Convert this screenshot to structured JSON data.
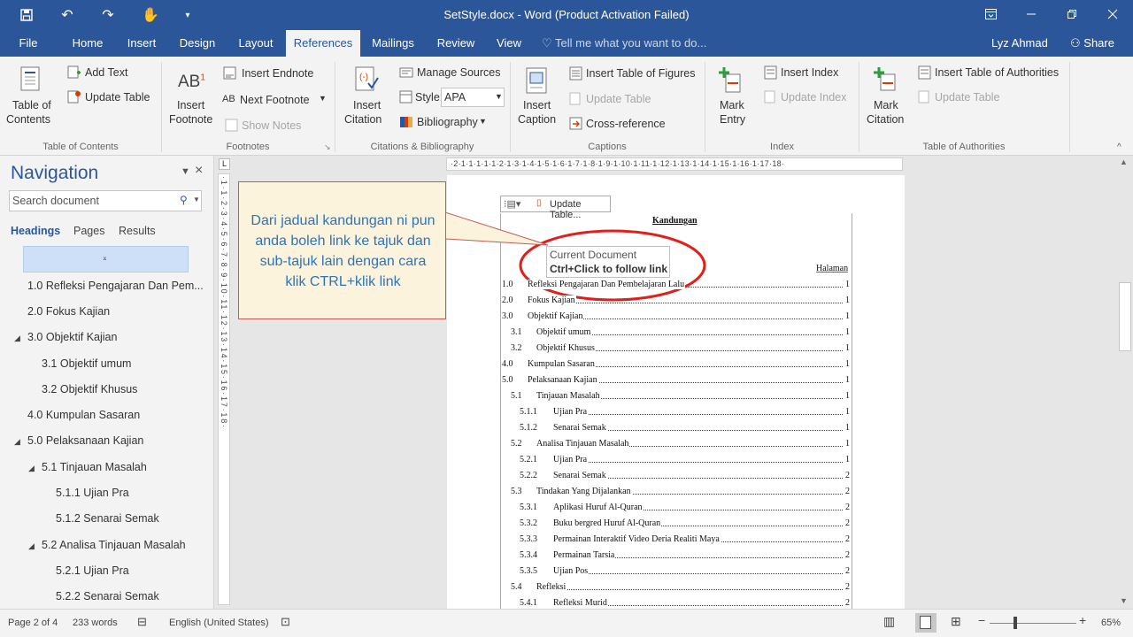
{
  "window": {
    "title": "SetStyle.docx - Word (Product Activation Failed)"
  },
  "tabs": [
    {
      "label": "File"
    },
    {
      "label": "Home"
    },
    {
      "label": "Insert"
    },
    {
      "label": "Design"
    },
    {
      "label": "Layout"
    },
    {
      "label": "References"
    },
    {
      "label": "Mailings"
    },
    {
      "label": "Review"
    },
    {
      "label": "View"
    }
  ],
  "tell_me": "Tell me what you want to do...",
  "user_name": "Lyz Ahmad",
  "share_label": "Share",
  "ribbon": {
    "toc": {
      "table_of_contents": "Table of",
      "table_of_contents_2": "Contents",
      "add_text": "Add Text",
      "update_table": "Update Table",
      "group": "Table of Contents"
    },
    "footnotes": {
      "insert_footnote": "Insert",
      "insert_footnote_2": "Footnote",
      "insert_endnote": "Insert Endnote",
      "next_footnote": "Next Footnote",
      "show_notes": "Show Notes",
      "group": "Footnotes"
    },
    "citations": {
      "insert_citation": "Insert",
      "insert_citation_2": "Citation",
      "manage_sources": "Manage Sources",
      "style_label": "Style:",
      "style_value": "APA",
      "bibliography": "Bibliography",
      "group": "Citations & Bibliography"
    },
    "captions": {
      "insert_caption": "Insert",
      "insert_caption_2": "Caption",
      "insert_table_of_figures": "Insert Table of Figures",
      "update_table": "Update Table",
      "cross_reference": "Cross-reference",
      "group": "Captions"
    },
    "index": {
      "mark_entry": "Mark",
      "mark_entry_2": "Entry",
      "insert_index": "Insert Index",
      "update_index": "Update Index",
      "group": "Index"
    },
    "authorities": {
      "mark_citation": "Mark",
      "mark_citation_2": "Citation",
      "insert_table_of_authorities": "Insert Table of Authorities",
      "update_table": "Update Table",
      "group": "Table of Authorities"
    }
  },
  "navigation": {
    "title": "Navigation",
    "search_placeholder": "Search document",
    "tabs": [
      "Headings",
      "Pages",
      "Results"
    ],
    "items": [
      {
        "label": "1.0 Refleksi Pengajaran Dan Pem..."
      },
      {
        "label": "2.0 Fokus Kajian"
      },
      {
        "label": "3.0 Objektif Kajian"
      },
      {
        "label": "3.1 Objektif umum"
      },
      {
        "label": "3.2 Objektif Khusus"
      },
      {
        "label": "4.0 Kumpulan Sasaran"
      },
      {
        "label": "5.0 Pelaksanaan Kajian"
      },
      {
        "label": "5.1 Tinjauan Masalah"
      },
      {
        "label": "5.1.1 Ujian Pra"
      },
      {
        "label": "5.1.2 Senarai Semak"
      },
      {
        "label": "5.2 Analisa Tinjauan Masalah"
      },
      {
        "label": "5.2.1 Ujian Pra"
      },
      {
        "label": "5.2.2 Senarai Semak"
      }
    ]
  },
  "ruler": {
    "horizontal": "·2·1·1·1·1·1·2·1·3·1·4·1·5·1·6·1·7·1·8·1·9·1·10·1·11·1·12·1·13·1·14·1·15·1·16·1·17·18·",
    "vertical": "·1·1·2·3·4·5·6·7·8·9·10·11·12·13·14·15·16·17·18·"
  },
  "document": {
    "update_table_label": "Update Table...",
    "toc_heading": "Kandungan",
    "page_header": "Halaman",
    "entries": [
      {
        "num": "1.0",
        "title": "Refleksi Pengajaran Dan Pembelajaran Lalu",
        "page": "1"
      },
      {
        "num": "2.0",
        "title": "Fokus Kajian",
        "page": "1"
      },
      {
        "num": "3.0",
        "title": "Objektif Kajian",
        "page": "1"
      },
      {
        "num": "3.1",
        "title": "Objektif umum",
        "page": "1"
      },
      {
        "num": "3.2",
        "title": "Objektif Khusus",
        "page": "1"
      },
      {
        "num": "4.0",
        "title": "Kumpulan Sasaran",
        "page": "1"
      },
      {
        "num": "5.0",
        "title": "Pelaksanaan Kajian",
        "page": "1"
      },
      {
        "num": "5.1",
        "title": "Tinjauan Masalah",
        "page": "1"
      },
      {
        "num": "5.1.1",
        "title": "Ujian Pra",
        "page": "1"
      },
      {
        "num": "5.1.2",
        "title": "Senarai Semak",
        "page": "1"
      },
      {
        "num": "5.2",
        "title": "Analisa Tinjauan Masalah",
        "page": "1"
      },
      {
        "num": "5.2.1",
        "title": "Ujian Pra",
        "page": "1"
      },
      {
        "num": "5.2.2",
        "title": "Senarai Semak",
        "page": "2"
      },
      {
        "num": "5.3",
        "title": "Tindakan Yang Dijalankan",
        "page": "2"
      },
      {
        "num": "5.3.1",
        "title": "Aplikasi Huruf Al-Quran",
        "page": "2"
      },
      {
        "num": "5.3.2",
        "title": "Buku bergred Huruf Al-Quran",
        "page": "2"
      },
      {
        "num": "5.3.3",
        "title": "Permainan Interaktif Video Deria Realiti Maya",
        "page": "2"
      },
      {
        "num": "5.3.4",
        "title": "Permainan Tarsia",
        "page": "2"
      },
      {
        "num": "5.3.5",
        "title": "Ujian Pos",
        "page": "2"
      },
      {
        "num": "5.4",
        "title": "Refleksi",
        "page": "2"
      },
      {
        "num": "5.4.1",
        "title": "Refleksi Murid",
        "page": "2"
      }
    ]
  },
  "tooltip": {
    "line1": "Current Document",
    "line2": "Ctrl+Click to follow link"
  },
  "callout": {
    "text": "Dari jadual kandungan ni pun anda boleh link ke tajuk dan sub-tajuk lain dengan cara klik CTRL+klik link"
  },
  "status": {
    "page": "Page 2 of 4",
    "words": "233 words",
    "language": "English (United States)",
    "zoom": "65%"
  },
  "colors": {
    "accent": "#2b579a",
    "callout_text": "#2e75b6",
    "callout_bg": "#fcf3dc",
    "highlight_circle": "#e0201b"
  }
}
